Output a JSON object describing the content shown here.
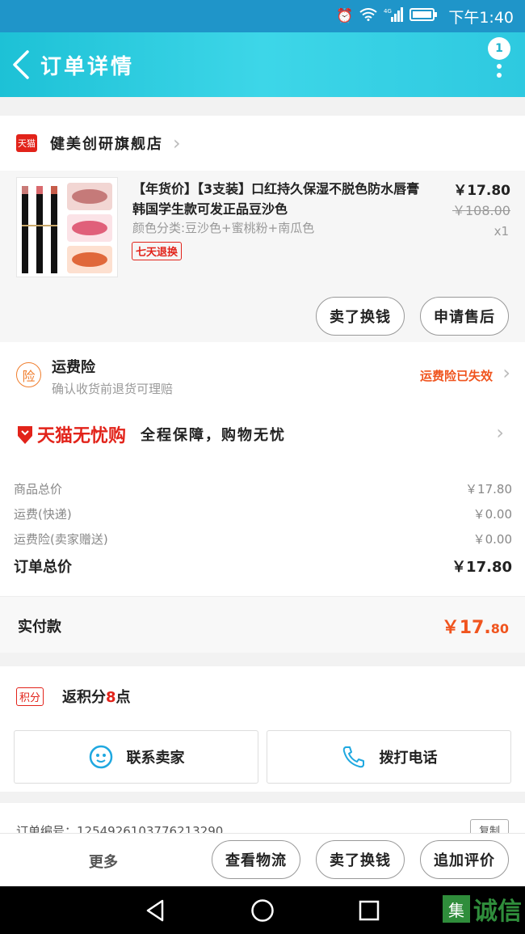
{
  "status_bar": {
    "time": "下午1:40",
    "network": "4G"
  },
  "header": {
    "title": "订单详情",
    "badge": "1"
  },
  "store": {
    "logo": "天猫",
    "name": "健美创研旗舰店"
  },
  "product": {
    "title": "【年货价】【3支装】口红持久保湿不脱色防水唇膏韩国学生款可发正品豆沙色",
    "sku": "颜色分类:豆沙色+蜜桃粉+南瓜色",
    "tag": "七天退换",
    "price": "￥17.80",
    "original_price": "￥108.00",
    "quantity": "x1",
    "buttons": {
      "exchange": "卖了换钱",
      "after_sale": "申请售后"
    }
  },
  "insurance": {
    "icon": "险",
    "title": "运费险",
    "subtitle": "确认收货前退货可理赔",
    "status": "运费险已失效"
  },
  "worry_free": {
    "logo": "天猫无忧购",
    "slogan": "全程保障，购物无忧"
  },
  "summary": {
    "rows": [
      {
        "label": "商品总价",
        "value": "￥17.80"
      },
      {
        "label": "运费(快递)",
        "value": "￥0.00"
      },
      {
        "label": "运费险(卖家赠送)",
        "value": "￥0.00"
      }
    ],
    "total_label": "订单总价",
    "total_value": "￥17.80",
    "paid_label": "实付款",
    "paid_int": "￥17.",
    "paid_dec": "80"
  },
  "points": {
    "tag": "积分",
    "text_before": "返积分",
    "num": "8",
    "text_after": "点"
  },
  "contact": {
    "seller": "联系卖家",
    "call": "拨打电话"
  },
  "order": {
    "number": "订单编号：1254926103776213290",
    "copy": "复制"
  },
  "bottom_bar": {
    "more": "更多",
    "logistics": "查看物流",
    "exchange": "卖了换钱",
    "review": "追加评价"
  },
  "watermark": {
    "box": "集",
    "text": "诚信"
  },
  "colors": {
    "header": "#2ec9e0",
    "accent": "#f0541e",
    "tmall_red": "#e2231a"
  }
}
